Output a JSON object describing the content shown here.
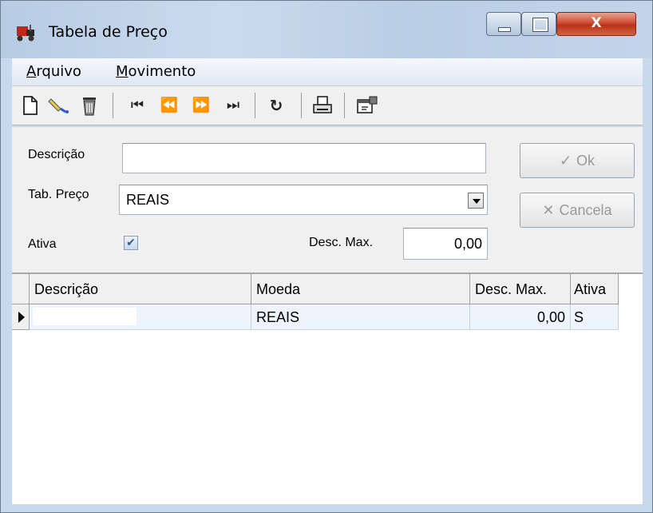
{
  "window": {
    "title": "Tabela de Preço",
    "controls": {
      "minimize": "minimize",
      "maximize": "maximize",
      "close": "X"
    }
  },
  "menu": [
    {
      "accel": "A",
      "rest": "rquivo"
    },
    {
      "accel": "M",
      "rest": "ovimento"
    }
  ],
  "toolbar": {
    "icons": [
      "new-icon",
      "edit-icon",
      "delete-icon",
      "first-icon",
      "prev-icon",
      "next-icon",
      "last-icon",
      "refresh-icon",
      "print-icon",
      "properties-icon"
    ]
  },
  "form": {
    "descricao_label": "Descrição",
    "descricao_value": "",
    "tabpreco_label": "Tab. Preço",
    "tabpreco_value": "REAIS",
    "ativa_label": "Ativa",
    "ativa_checked": true,
    "descmax_label": "Desc. Max.",
    "descmax_value": "0,00",
    "ok_label": "Ok",
    "cancela_label": "Cancela"
  },
  "grid": {
    "columns": [
      "Descrição",
      "Moeda",
      "Desc. Max.",
      "Ativa"
    ],
    "rows": [
      {
        "descricao": "",
        "moeda": "REAIS",
        "descmax": "0,00",
        "ativa": "S"
      }
    ]
  }
}
